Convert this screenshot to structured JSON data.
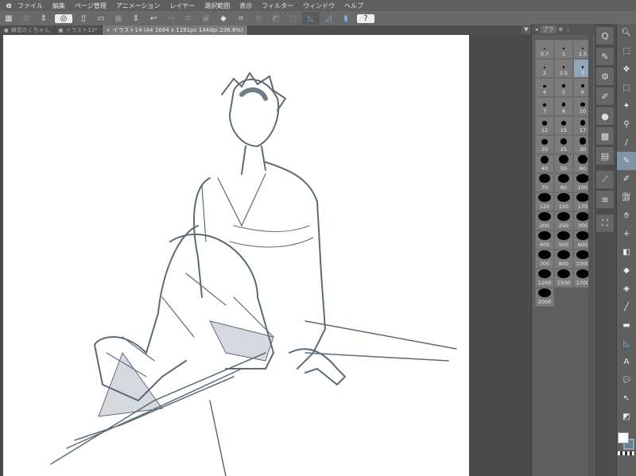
{
  "menu": {
    "items": [
      "ファイル",
      "編集",
      "ページ管理",
      "アニメーション",
      "レイヤー",
      "選択範囲",
      "表示",
      "フィルター",
      "ウィンドウ",
      "ヘルプ"
    ]
  },
  "tabs": [
    {
      "label": "練習のくちゃん",
      "active": false
    },
    {
      "label": "イラスト13*",
      "active": false
    },
    {
      "label": "イラスト14 (A4 1684 x 1191px 144dpi 236.8%)",
      "active": true
    }
  ],
  "brush_panel": {
    "tab_label": "ブラ",
    "selected": "3",
    "sizes": [
      "0.7",
      "1",
      "1.5",
      "2",
      "2.5",
      "3",
      "4",
      "5",
      "6",
      "7",
      "8",
      "10",
      "12",
      "15",
      "17",
      "20",
      "25",
      "30",
      "40",
      "50",
      "60",
      "70",
      "80",
      "100",
      "120",
      "150",
      "170",
      "200",
      "250",
      "300",
      "400",
      "500",
      "600",
      "700",
      "800",
      "1000",
      "1200",
      "1500",
      "1700",
      "2000"
    ]
  },
  "colors": {
    "main": "#ffffff",
    "sub": "#6d7f8c",
    "accent": "#8fa7b8",
    "line": "#5c6b78"
  }
}
